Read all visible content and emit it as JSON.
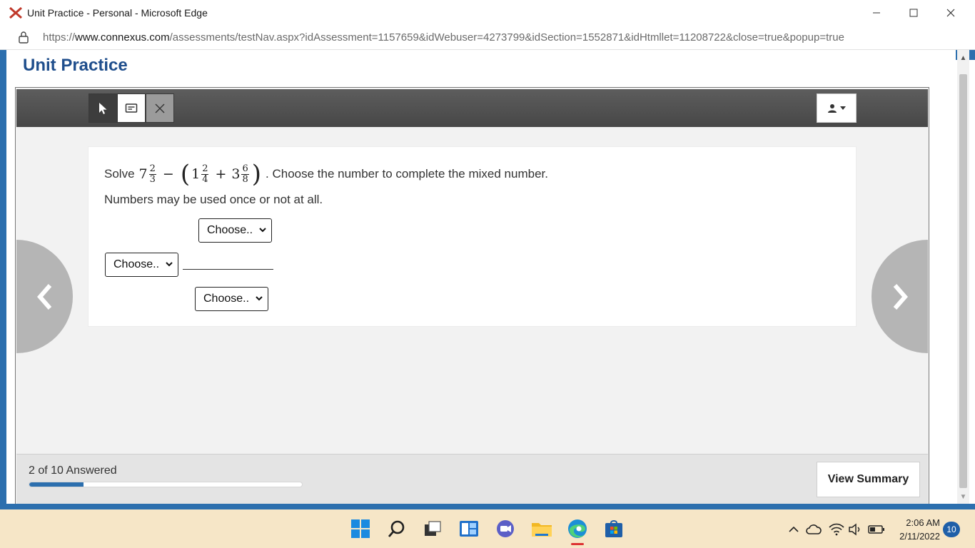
{
  "window": {
    "title": "Unit Practice - Personal - Microsoft Edge",
    "url_prefix": "https://",
    "url_host": "www.connexus.com",
    "url_path": "/assessments/testNav.aspx?idAssessment=1157659&idWebuser=4273799&idSection=1552871&idHtmllet=11208722&close=true&popup=true"
  },
  "page": {
    "title": "Unit Practice"
  },
  "question": {
    "solve_word": "Solve",
    "expr": {
      "a_whole": "7",
      "a_num": "2",
      "a_den": "3",
      "minus": "−",
      "open_paren": "(",
      "b_whole": "1",
      "b_num": "2",
      "b_den": "4",
      "plus": "+",
      "c_whole": "3",
      "c_num": "6",
      "c_den": "8",
      "close_paren": ")"
    },
    "prompt_tail": ". Choose the number to complete the mixed number.",
    "instruction": "Numbers may be used once or not at all.",
    "numerator_select": "Choose..",
    "whole_select": "Choose..",
    "denominator_select": "Choose.."
  },
  "footer": {
    "answered_text": "2 of 10 Answered",
    "progress_fraction": 0.2,
    "view_summary_label": "View Summary"
  },
  "taskbar": {
    "time": "2:06 AM",
    "date": "2/11/2022",
    "notifications": "10"
  },
  "colors": {
    "title_blue": "#1f4e8c",
    "accent_blue": "#2c6fae",
    "taskbar_bg": "#f6e6c7"
  }
}
